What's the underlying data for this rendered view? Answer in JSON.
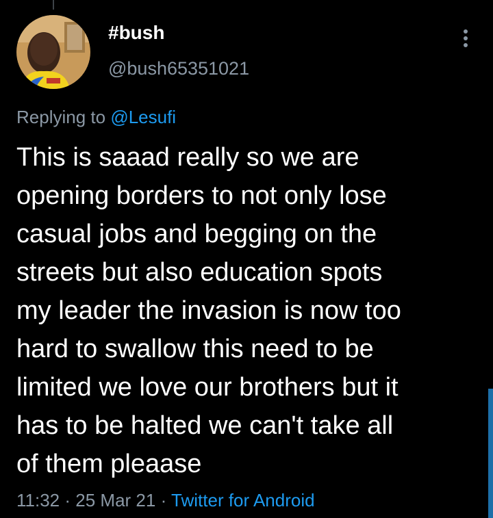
{
  "user": {
    "display_name": "#bush",
    "handle": "@bush65351021"
  },
  "reply": {
    "prefix": "Replying to",
    "mention": "@Lesufi"
  },
  "tweet": {
    "text": "This is saaad really so we are\nopening borders to not only lose\ncasual jobs and begging on the\nstreets but also education spots\nmy leader the invasion is now too\nhard to swallow this need to be\nlimited we love our brothers but it\nhas to be halted we can't take all\nof them pleaase"
  },
  "meta": {
    "time": "11:32",
    "separator": "·",
    "date": "25 Mar 21",
    "source": "Twitter for Android"
  },
  "icons": {
    "more": "more-vertical-icon"
  },
  "colors": {
    "background": "#000000",
    "text": "#ffffff",
    "secondary": "#8b98a5",
    "accent": "#1d9bf0"
  }
}
